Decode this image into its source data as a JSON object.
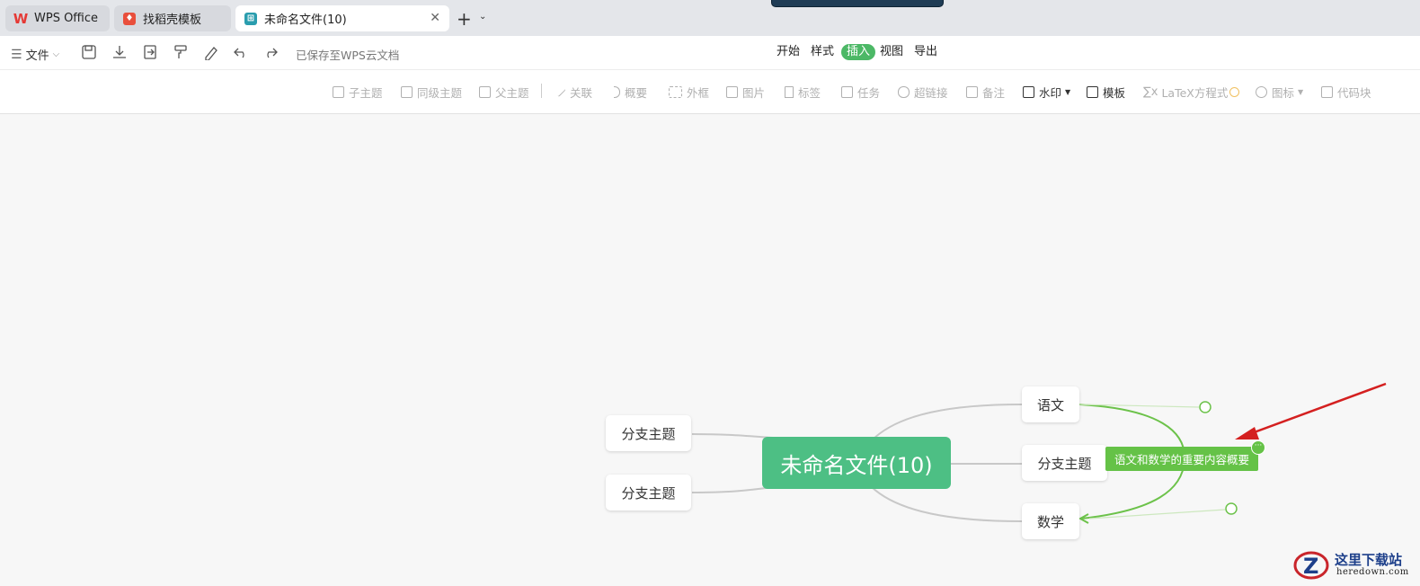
{
  "tabs": [
    {
      "label": "WPS Office",
      "icon": "wps-logo-icon",
      "color": "#e53935"
    },
    {
      "label": "找稻壳模板",
      "icon": "docer-icon",
      "color": "#e94f3c"
    },
    {
      "label": "未命名文件(10)",
      "icon": "mindmap-file-icon",
      "color": "#2a9dae"
    }
  ],
  "menubar": {
    "file_label": "文件",
    "saved_status": "已保存至WPS云文档",
    "tabs": [
      "开始",
      "样式",
      "插入",
      "视图",
      "导出"
    ],
    "active_tab": "插入"
  },
  "toolbar": {
    "items": [
      {
        "label": "子主题",
        "icon": "child-topic-icon",
        "enabled": false
      },
      {
        "label": "同级主题",
        "icon": "sibling-topic-icon",
        "enabled": false
      },
      {
        "label": "父主题",
        "icon": "parent-topic-icon",
        "enabled": false
      },
      {
        "label": "关联",
        "icon": "relation-icon",
        "enabled": false
      },
      {
        "label": "概要",
        "icon": "summary-icon",
        "enabled": false
      },
      {
        "label": "外框",
        "icon": "boundary-icon",
        "enabled": false
      },
      {
        "label": "图片",
        "icon": "image-icon",
        "enabled": false
      },
      {
        "label": "标签",
        "icon": "tag-icon",
        "enabled": false
      },
      {
        "label": "任务",
        "icon": "task-icon",
        "enabled": false
      },
      {
        "label": "超链接",
        "icon": "hyperlink-icon",
        "enabled": false
      },
      {
        "label": "备注",
        "icon": "note-icon",
        "enabled": false
      },
      {
        "label": "水印",
        "icon": "watermark-icon",
        "enabled": true
      },
      {
        "label": "模板",
        "icon": "template-icon",
        "enabled": true
      },
      {
        "label": "LaTeX方程式",
        "icon": "latex-icon",
        "enabled": false
      },
      {
        "label": "图标",
        "icon": "emoji-icon",
        "enabled": false
      },
      {
        "label": "代码块",
        "icon": "code-block-icon",
        "enabled": false
      }
    ]
  },
  "mindmap": {
    "root": "未命名文件(10)",
    "left_branches": [
      "分支主题",
      "分支主题"
    ],
    "right_branches": [
      "语文",
      "分支主题",
      "数学"
    ],
    "summary": "语文和数学的重要内容概要",
    "summary_more": "···"
  },
  "colors": {
    "root": "#4dbf84",
    "summary": "#65c247",
    "active_tab": "#4cb866",
    "arrow": "#d42020"
  },
  "watermark": {
    "title": "这里下载站",
    "url": "heredown.com"
  }
}
